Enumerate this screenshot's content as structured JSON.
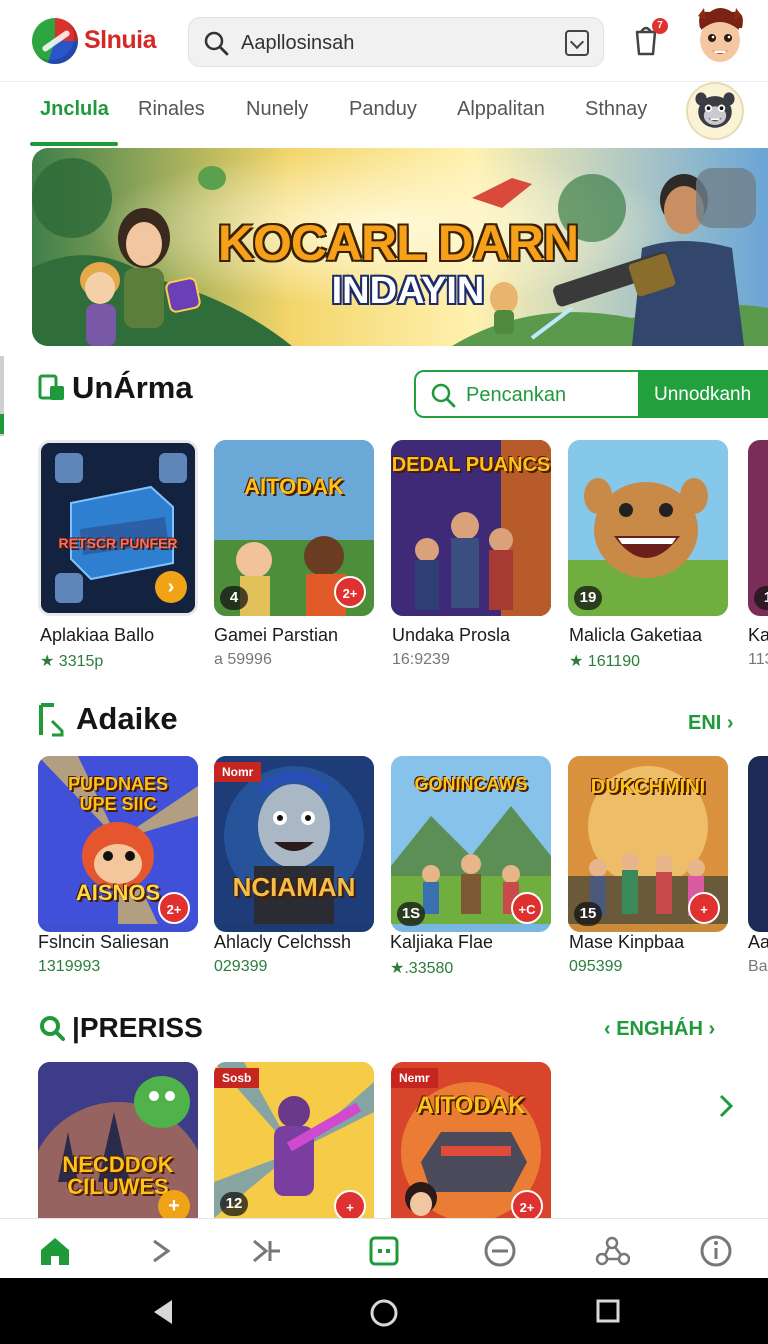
{
  "header": {
    "brand": "Slnuia",
    "search_text": "Aapllosinsah",
    "notification_count": "7"
  },
  "tabs": [
    {
      "label": "Jnclula",
      "active": true
    },
    {
      "label": "Rinales",
      "active": false
    },
    {
      "label": "Nunely",
      "active": false
    },
    {
      "label": "Panduy",
      "active": false
    },
    {
      "label": "Alppalitan",
      "active": false
    },
    {
      "label": "Sthnay",
      "active": false
    }
  ],
  "banner": {
    "title": "KOCARL DARN",
    "subtitle": "INDAYIN"
  },
  "section1": {
    "title": "UnÁrma",
    "filter_placeholder": "Pencankan",
    "filter_button": "Unnodkanh",
    "cards": [
      {
        "name": "Aplakiaa Ballo",
        "meta": "3315p",
        "starred": true,
        "art": "RETSCR PUNFER",
        "number": "",
        "badge": ""
      },
      {
        "name": "Gamei Parstian",
        "meta": "a 59996",
        "starred": false,
        "art": "AITODAK",
        "number": "4",
        "badge": "2+"
      },
      {
        "name": "Undaka Prosla",
        "meta": "16:9239",
        "starred": false,
        "art": "DEDAL PUANCS",
        "number": "",
        "badge": ""
      },
      {
        "name": "Malicla Gaketiaa",
        "meta": "161190",
        "starred": true,
        "art": "",
        "number": "19",
        "badge": ""
      },
      {
        "name": "Ka",
        "meta": "113",
        "starred": false,
        "art": "",
        "number": "1",
        "badge": ""
      }
    ]
  },
  "section2": {
    "title": "Adaike",
    "link": "ENI",
    "cards": [
      {
        "name": "Fslncin Saliesan",
        "meta": "1319993",
        "art": "PUPDNAES UPE SIIC",
        "art2": "AISNOS",
        "number": "",
        "badge": "2+",
        "ribbon": ""
      },
      {
        "name": "Ahlacly Celchssh",
        "meta": "029399",
        "art": "NCIAMAN",
        "art2": "",
        "number": "",
        "badge": "",
        "ribbon": "Nomr"
      },
      {
        "name": "Kaljiaka Flae",
        "meta": ".33580",
        "starred": true,
        "art": "GONINCAWS",
        "art2": "",
        "number": "1S",
        "badge": "+C",
        "ribbon": ""
      },
      {
        "name": "Mase Kinpbaa",
        "meta": "095399",
        "art": "DUKCHMINI",
        "art2": "",
        "number": "15",
        "badge": "+",
        "ribbon": ""
      },
      {
        "name": "Aa",
        "meta": "Ba",
        "art": "",
        "art2": "",
        "number": "",
        "badge": "",
        "ribbon": ""
      }
    ]
  },
  "section3": {
    "title": "|PRERISS",
    "link": "ENGHÁH",
    "cards": [
      {
        "art": "NECDDOK CILUWES",
        "ribbon": "",
        "number": "",
        "badge": "+"
      },
      {
        "art": "",
        "ribbon": "Sosb",
        "number": "12",
        "badge": "+"
      },
      {
        "art": "AITODAK",
        "ribbon": "Nemr",
        "number": "",
        "badge": "2+"
      }
    ]
  },
  "colors": {
    "accent": "#1f9a3a",
    "brand_red": "#d62828"
  },
  "icons": [
    "home-icon",
    "chevron-right-icon",
    "skip-icon",
    "grid-square-icon",
    "minus-circle-icon",
    "share-nodes-icon",
    "info-icon",
    "back-triangle-icon",
    "home-circle-icon",
    "recents-square-icon"
  ]
}
